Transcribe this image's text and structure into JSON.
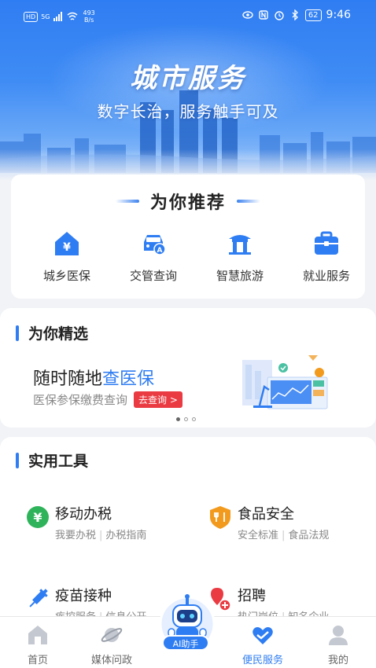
{
  "status_bar": {
    "hd": "HD",
    "signal": "5G",
    "speed_value": "493",
    "speed_unit": "B/s",
    "battery": "62",
    "time": "9:46"
  },
  "hero": {
    "title": "城市服务",
    "subtitle": "数字长治，服务触手可及"
  },
  "recommend": {
    "title": "为你推荐",
    "items": [
      {
        "label": "城乡医保",
        "icon": "medical-insurance-icon"
      },
      {
        "label": "交管查询",
        "icon": "car-icon"
      },
      {
        "label": "智慧旅游",
        "icon": "pavilion-icon"
      },
      {
        "label": "就业服务",
        "icon": "briefcase-icon"
      }
    ]
  },
  "selection": {
    "title": "为你精选",
    "promo_main": "随时随地",
    "promo_highlight": "查医保",
    "promo_sub": "医保参保缴费查询",
    "promo_button": "去查询 >",
    "dots_total": 3,
    "dots_active": 1
  },
  "tools": {
    "title": "实用工具",
    "items": [
      {
        "name": "移动办税",
        "desc1": "我要办税",
        "desc2": "办税指南",
        "icon": "tax-icon"
      },
      {
        "name": "食品安全",
        "desc1": "安全标准",
        "desc2": "食品法规",
        "icon": "food-safety-icon"
      },
      {
        "name": "疫苗接种",
        "desc1": "疾控服务",
        "desc2": "信息公开",
        "icon": "syringe-icon"
      },
      {
        "name": "招聘",
        "desc1": "热门岗位",
        "desc2": "知名企业",
        "icon": "recruit-icon"
      }
    ]
  },
  "nav": {
    "items": [
      {
        "label": "首页",
        "icon": "home-icon"
      },
      {
        "label": "媒体问政",
        "icon": "planet-icon"
      },
      {
        "label": "便民服务",
        "icon": "heart-hands-icon",
        "active": true
      },
      {
        "label": "我的",
        "icon": "user-icon"
      }
    ],
    "ai_label": "AI助手"
  },
  "colors": {
    "accent": "#2f7df2",
    "promo_button": "#ea3b42",
    "tax_green": "#2fb35a",
    "food_orange": "#f29a1d"
  }
}
